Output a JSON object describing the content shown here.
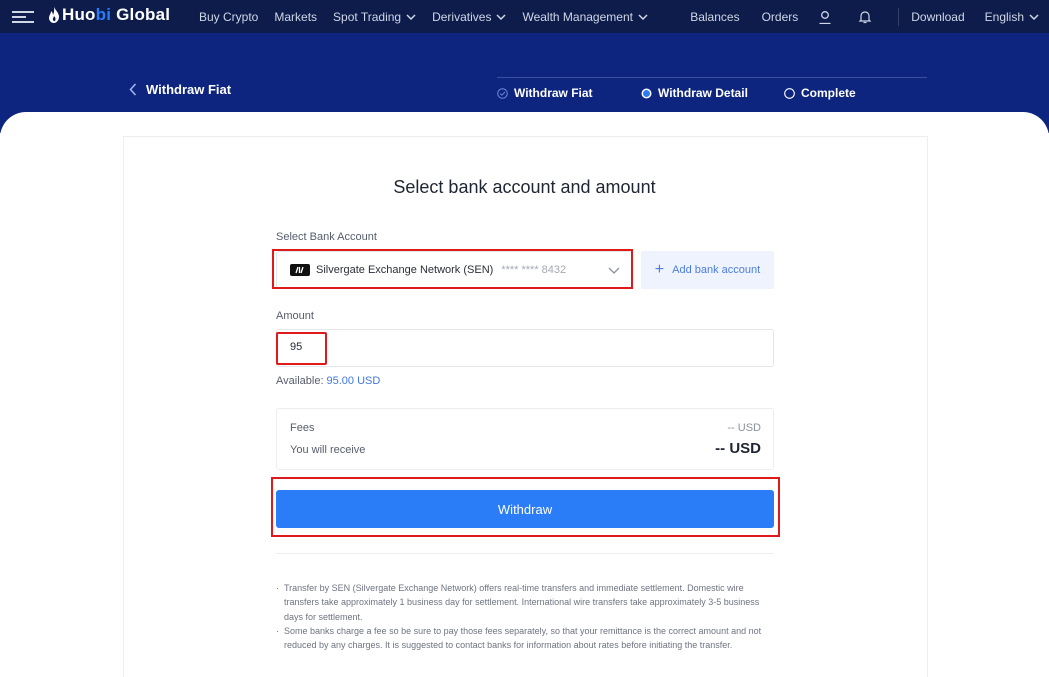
{
  "nav": {
    "logo_prefix": "Huo",
    "logo_bi": "bi",
    "logo_suffix": " Global",
    "links": [
      "Buy Crypto",
      "Markets",
      "Spot Trading",
      "Derivatives",
      "Wealth Management"
    ],
    "balances": "Balances",
    "orders": "Orders",
    "download": "Download",
    "language": "English"
  },
  "header": {
    "back_label": "Withdraw Fiat",
    "steps": [
      "Withdraw Fiat",
      "Withdraw Detail",
      "Complete"
    ]
  },
  "form": {
    "title": "Select bank account and amount",
    "bank_label": "Select Bank Account",
    "bank_name": "Silvergate Exchange Network (SEN)",
    "bank_mask": "**** **** 8432",
    "add_bank": "Add bank account",
    "amount_label": "Amount",
    "amount_value": "95",
    "available_label": "Available:",
    "available_value": "95.00 USD",
    "fees_label": "Fees",
    "fees_value": "-- USD",
    "receive_label": "You will receive",
    "receive_value": "-- USD",
    "withdraw_button": "Withdraw"
  },
  "notes": [
    "Transfer by SEN (Silvergate Exchange Network) offers real-time transfers and immediate settlement. Domestic wire transfers take approximately 1 business day for settlement. International wire transfers take approximately 3-5 business days for settlement.",
    " Some banks charge a fee so be sure to pay those fees separately, so that your remittance is the correct amount and not reduced by any charges. It is suggested to contact banks for information about rates before initiating the transfer."
  ],
  "colors": {
    "nav_bg": "#0d1c4b",
    "hero_bg": "#0e2580",
    "accent": "#2b7cf7",
    "highlight": "#e0191b"
  }
}
